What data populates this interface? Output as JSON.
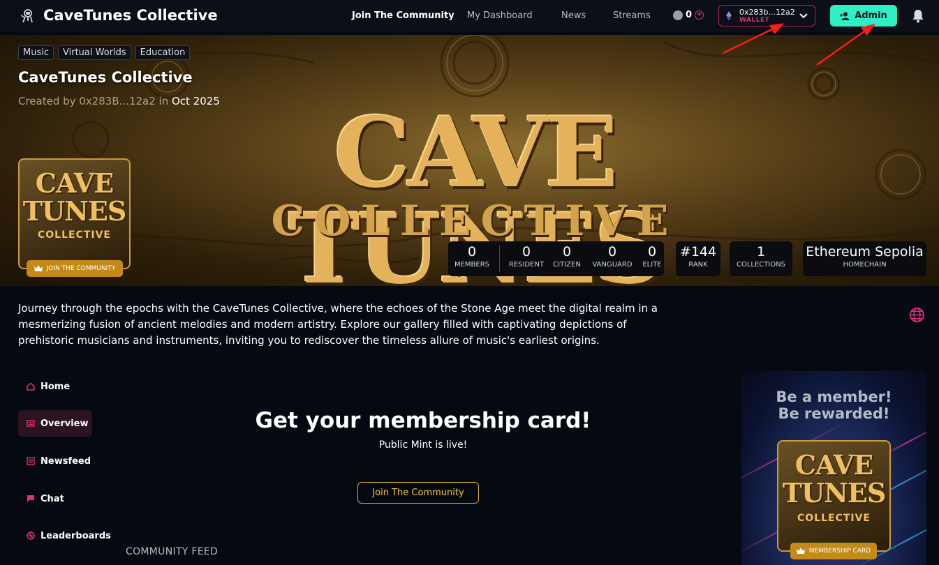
{
  "header": {
    "title": "CaveTunes Collective",
    "nav": [
      "Join The Community",
      "My Dashboard",
      "News",
      "Streams"
    ],
    "points": "0",
    "wallet": {
      "address": "0x283b...12a2",
      "label": "WALLET"
    },
    "admin_label": "Admin"
  },
  "hero": {
    "tags": [
      "Music",
      "Virtual Worlds",
      "Education"
    ],
    "title": "CaveTunes Collective",
    "created_prefix": "Created by 0x283B...12a2 in",
    "created_date": "Oct 2025",
    "banner_main": "CAVE TUNES",
    "banner_sub": "COLLECTIVE",
    "avatar_line1": "CAVE",
    "avatar_line2": "TUNES",
    "avatar_line3": "COLLECTIVE",
    "join_pill": "JOIN THE COMMUNITY",
    "stats": {
      "members": {
        "value": "0",
        "label": "MEMBERS"
      },
      "resident": {
        "value": "0",
        "label": "RESIDENT"
      },
      "citizen": {
        "value": "0",
        "label": "CITIZEN"
      },
      "vanguard": {
        "value": "0",
        "label": "VANGUARD"
      },
      "elite": {
        "value": "0",
        "label": "ELITE"
      },
      "rank": {
        "value": "#144",
        "label": "RANK"
      },
      "collections": {
        "value": "1",
        "label": "COLLECTIONS"
      },
      "homechain": {
        "value": "Ethereum Sepolia",
        "label": "HOMECHAIN"
      }
    }
  },
  "description": "Journey through the epochs with the CaveTunes Collective, where the echoes of the Stone Age meet the digital realm in a mesmerizing fusion of ancient melodies and modern artistry. Explore our gallery filled with captivating depictions of prehistoric musicians and instruments, inviting you to rediscover the timeless allure of music's earliest origins.",
  "sidebar": {
    "items": [
      {
        "label": "Home",
        "icon": "home-icon"
      },
      {
        "label": "Overview",
        "icon": "overview-icon",
        "active": true
      },
      {
        "label": "Newsfeed",
        "icon": "newsfeed-icon"
      },
      {
        "label": "Chat",
        "icon": "chat-icon"
      },
      {
        "label": "Leaderboards",
        "icon": "leaderboard-icon"
      }
    ]
  },
  "main": {
    "cta_title": "Get your membership card!",
    "cta_sub": "Public Mint is live!",
    "cta_button": "Join The Community",
    "feed_label": "COMMUNITY FEED"
  },
  "panel": {
    "line1": "Be a member!",
    "line2": "Be rewarded!",
    "card_line1": "CAVE",
    "card_line2": "TUNES",
    "card_line3": "COLLECTIVE",
    "card_pill": "MEMBERSHIP CARD"
  },
  "colors": {
    "accent_pink": "#e0307a",
    "admin_teal": "#2ef0c4",
    "gold": "#c48a18",
    "cta_yellow": "#f0c824",
    "annotation_red": "#ff1a1a"
  }
}
